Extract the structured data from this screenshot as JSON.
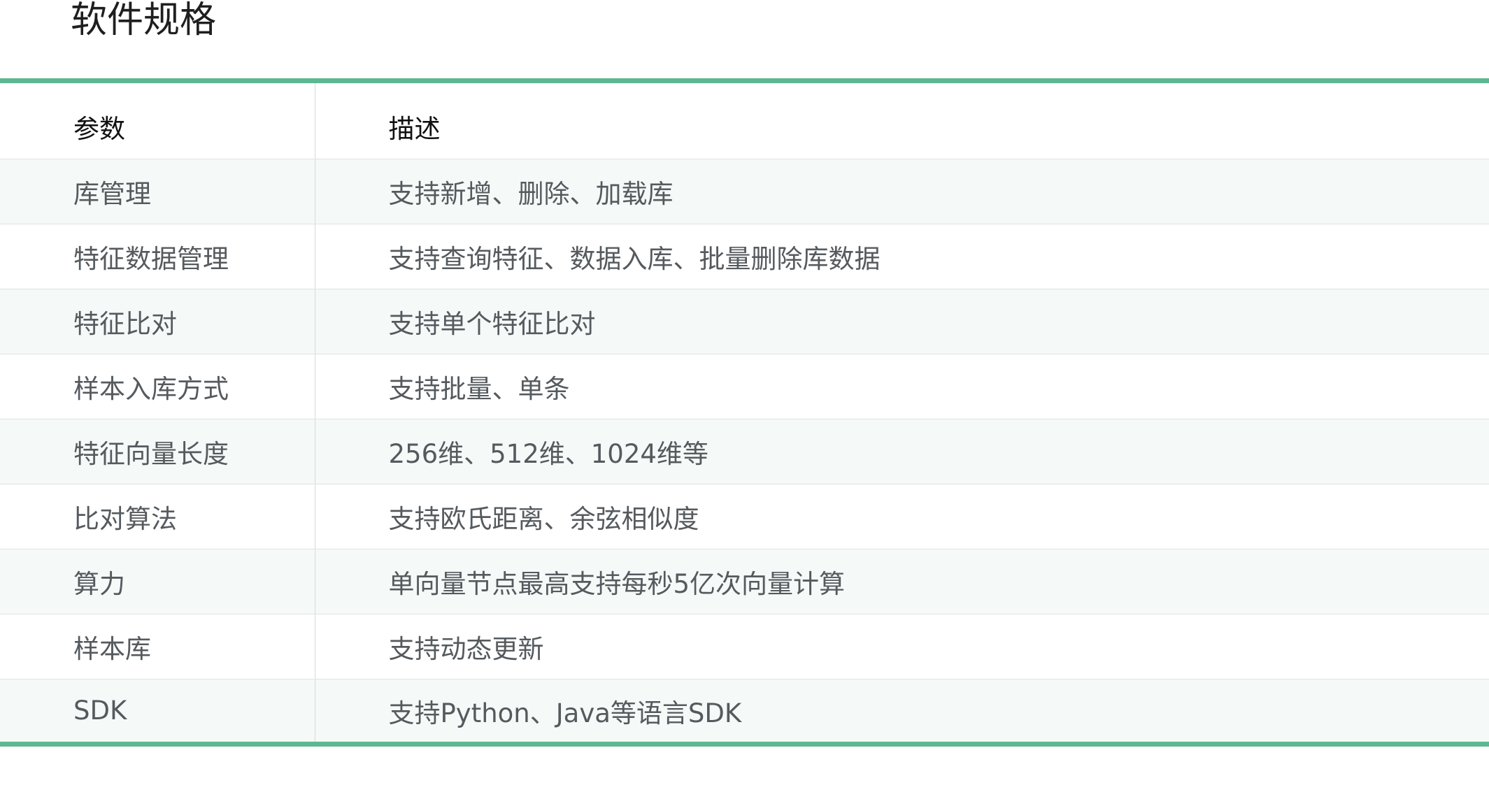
{
  "page": {
    "title": "软件规格"
  },
  "table": {
    "headers": {
      "param": "参数",
      "desc": "描述"
    },
    "rows": [
      {
        "param": "库管理",
        "desc": "支持新增、删除、加载库"
      },
      {
        "param": "特征数据管理",
        "desc": "支持查询特征、数据入库、批量删除库数据"
      },
      {
        "param": "特征比对",
        "desc": "支持单个特征比对"
      },
      {
        "param": "样本入库方式",
        "desc": "支持批量、单条"
      },
      {
        "param": "特征向量长度",
        "desc": "256维、512维、1024维等"
      },
      {
        "param": "比对算法",
        "desc": "支持欧氏距离、余弦相似度"
      },
      {
        "param": "算力",
        "desc": "单向量节点最高支持每秒5亿次向量计算"
      },
      {
        "param": "样本库",
        "desc": "支持动态更新"
      },
      {
        "param": "SDK",
        "desc": "支持Python、Java等语言SDK"
      }
    ]
  },
  "colors": {
    "accent": "#5cb892",
    "stripe": "#f5f9f8",
    "text": "#555a5e",
    "header_text": "#111111"
  }
}
